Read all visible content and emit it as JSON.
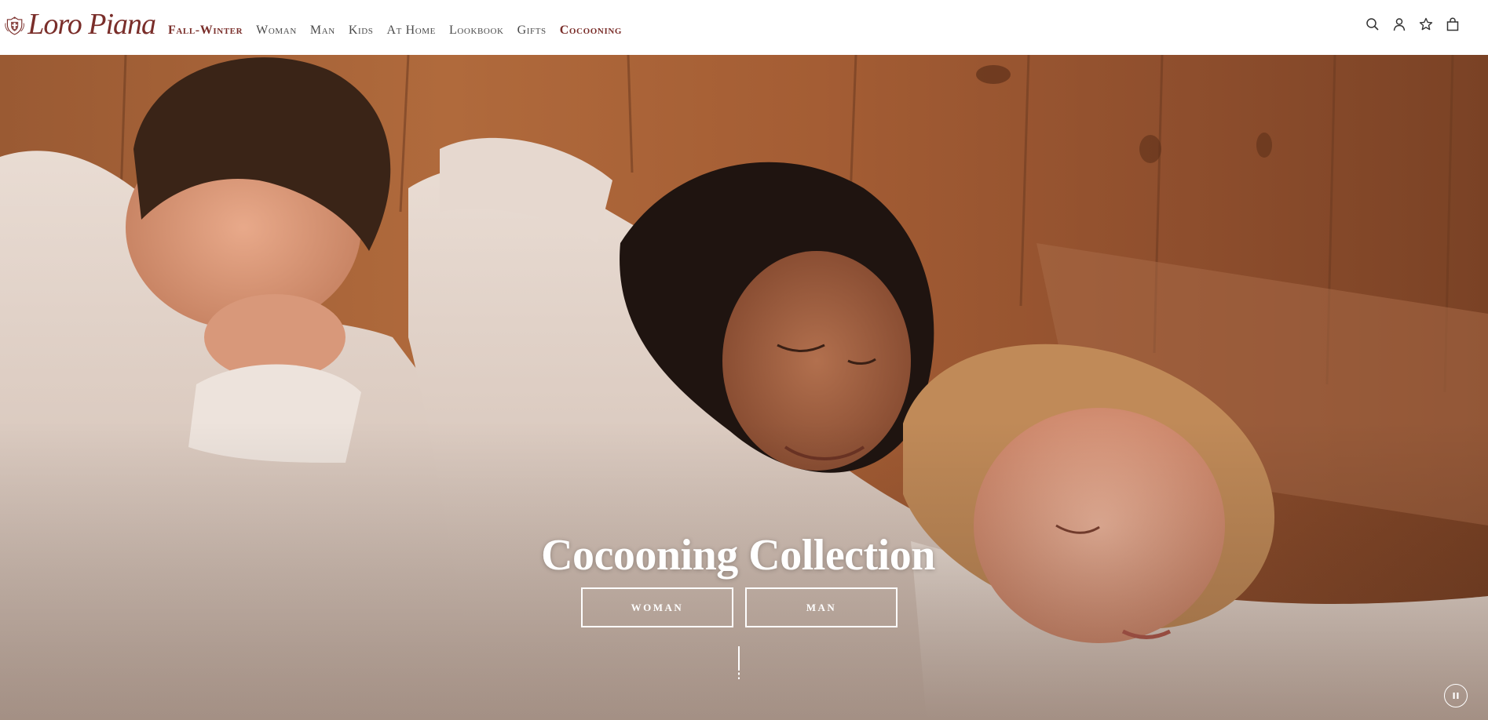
{
  "brand": {
    "name": "Loro Piana",
    "accent_color": "#7a2e2a"
  },
  "nav": {
    "items": [
      {
        "label": "Fall-Winter",
        "accent": true
      },
      {
        "label": "Woman",
        "accent": false
      },
      {
        "label": "Man",
        "accent": false
      },
      {
        "label": "Kids",
        "accent": false
      },
      {
        "label": "At Home",
        "accent": false
      },
      {
        "label": "Lookbook",
        "accent": false
      },
      {
        "label": "Gifts",
        "accent": false
      },
      {
        "label": "Cocooning",
        "accent": true
      }
    ]
  },
  "header_icons": [
    "search-icon",
    "account-icon",
    "wishlist-icon",
    "shopping-bag-icon"
  ],
  "hero": {
    "title": "Cocooning Collection",
    "buttons": [
      {
        "label": "WOMAN"
      },
      {
        "label": "MAN"
      }
    ],
    "pause_icon": "pause-icon"
  }
}
